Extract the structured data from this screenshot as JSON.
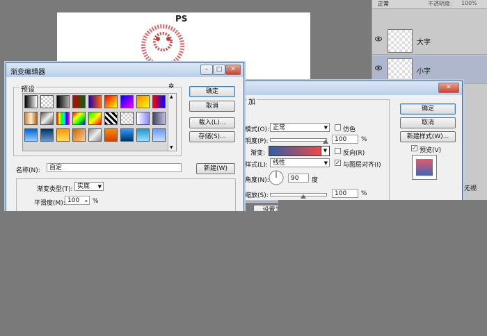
{
  "canvas": {
    "title": "PS"
  },
  "layers_panel": {
    "blend_mode": "正常",
    "opacity_label": "不透明度:",
    "opacity_value": "100%",
    "layers": [
      {
        "name": "大字",
        "selected": false
      },
      {
        "name": "小字",
        "selected": true
      }
    ],
    "partial_label": "无视"
  },
  "gradient_editor": {
    "title": "渐变编辑器",
    "presets_label": "预设",
    "gear_icon": "gear-icon",
    "buttons": {
      "ok": "确定",
      "cancel": "取消",
      "load": "载入(L)...",
      "save": "存储(S)...",
      "new": "新建(W)"
    },
    "name_label": "名称(N):",
    "name_value": "自定",
    "type_label": "渐变类型(T):",
    "type_value": "实底",
    "smooth_label": "平滑度(M):",
    "smooth_value": "100",
    "smooth_unit": "%"
  },
  "layer_style": {
    "section_title": "加",
    "buttons": {
      "ok": "确定",
      "cancel": "取消",
      "new_style": "新建样式(W)...",
      "reset": "设置为"
    },
    "preview_label": "预览(V)",
    "blend_label": "模式(O):",
    "blend_value": "正常",
    "dither_label": "仿色",
    "opacity_label": "明度(P):",
    "opacity_value": "100",
    "opacity_unit": "%",
    "gradient_label": "渐变:",
    "reverse_label": "反向(R)",
    "style_label": "样式(L):",
    "style_value": "线性",
    "align_label": "与图层对齐(I)",
    "angle_label": "角度(N):",
    "angle_value": "90",
    "angle_unit": "度",
    "scale_label": "缩放(S):",
    "scale_value": "100",
    "scale_unit": "%"
  }
}
